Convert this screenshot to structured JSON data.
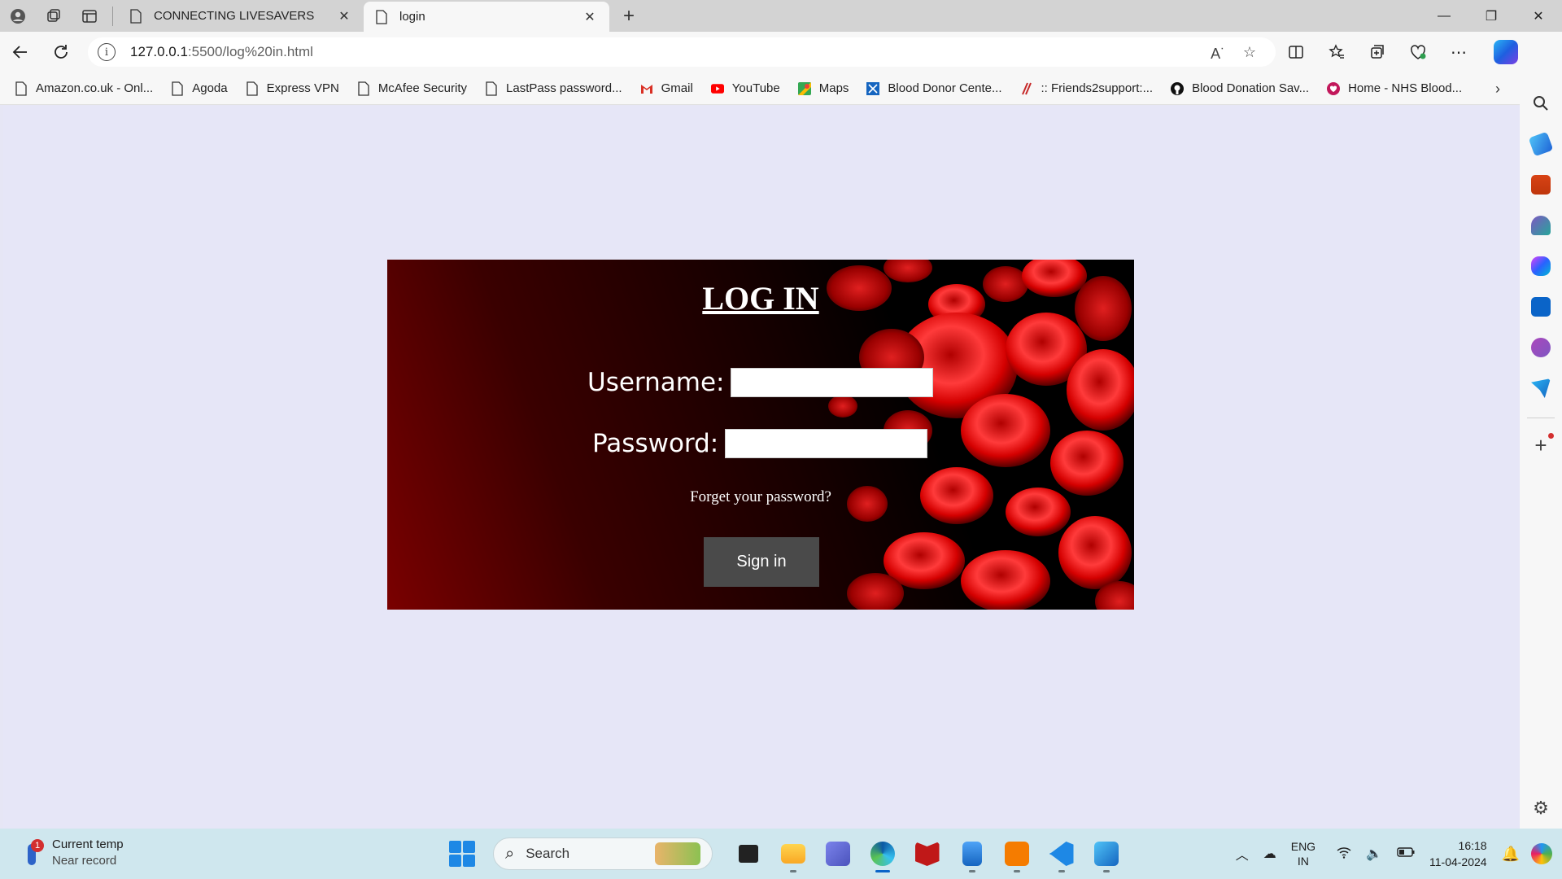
{
  "browser": {
    "tabs": [
      {
        "title": "CONNECTING LIVESAVERS",
        "active": false
      },
      {
        "title": "login",
        "active": true
      }
    ],
    "new_tab": "+",
    "window_controls": {
      "minimize": "—",
      "restore": "❐",
      "close": "✕"
    },
    "address": {
      "host": "127.0.0.1",
      "path": ":5500/log%20in.html"
    },
    "bookmarks": [
      {
        "label": "Amazon.co.uk - Onl...",
        "icon": "page-icon"
      },
      {
        "label": "Agoda",
        "icon": "page-icon"
      },
      {
        "label": "Express VPN",
        "icon": "page-icon"
      },
      {
        "label": "McAfee Security",
        "icon": "page-icon"
      },
      {
        "label": "LastPass password...",
        "icon": "page-icon"
      },
      {
        "label": "Gmail",
        "icon": "gmail-icon"
      },
      {
        "label": "YouTube",
        "icon": "youtube-icon"
      },
      {
        "label": "Maps",
        "icon": "maps-icon"
      },
      {
        "label": "Blood Donor Cente...",
        "icon": "blood-donor-icon"
      },
      {
        "label": ":: Friends2support:...",
        "icon": "friends2support-icon"
      },
      {
        "label": "Blood Donation Sav...",
        "icon": "github-icon"
      },
      {
        "label": "Home - NHS Blood...",
        "icon": "nhs-blood-icon"
      }
    ]
  },
  "login": {
    "title": "LOG IN",
    "username_label": "Username:",
    "password_label": "Password:",
    "forgot_link": "Forget your password?",
    "signin_button": "Sign in"
  },
  "taskbar": {
    "weather": {
      "badge": "1",
      "title": "Current temp",
      "subtitle": "Near record"
    },
    "search_placeholder": "Search",
    "language": {
      "line1": "ENG",
      "line2": "IN"
    },
    "clock": {
      "time": "16:18",
      "date": "11-04-2024"
    }
  },
  "colors": {
    "page_bg": "#e6e6f7",
    "card_dark": "#000000",
    "card_red": "#7a0000",
    "button_bg": "#4a4a4a"
  }
}
